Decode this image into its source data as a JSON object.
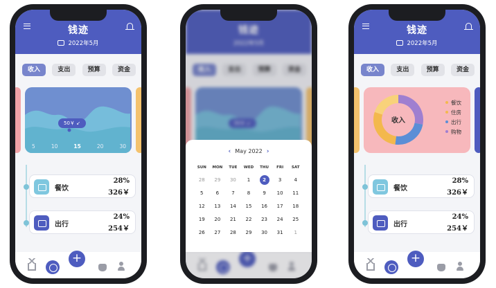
{
  "app": {
    "title": "钱迹",
    "month": "2022年5月"
  },
  "tabs": [
    "收入",
    "支出",
    "预算",
    "资金"
  ],
  "income_chart": {
    "x_ticks": [
      "5",
      "10",
      "15",
      "20",
      "30"
    ],
    "selected_tick": "15",
    "tooltip": "50￥ ↙"
  },
  "pie": {
    "center_label": "收入",
    "legend": [
      {
        "label": "餐饮",
        "color": "#f3b84d"
      },
      {
        "label": "住房",
        "color": "#f3b84d"
      },
      {
        "label": "出行",
        "color": "#5b8ed6"
      },
      {
        "label": "购物",
        "color": "#9f7fd0"
      }
    ],
    "slices": [
      {
        "name": "",
        "value": 28,
        "color": "#9f7fd0"
      },
      {
        "name": "",
        "value": 24,
        "color": "#5b8ed6"
      },
      {
        "name": "",
        "value": 28,
        "color": "#f3b84d"
      },
      {
        "name": "",
        "value": 20,
        "color": "#f8d27a"
      }
    ]
  },
  "entries": [
    {
      "label": "餐饮",
      "percent": "28%",
      "amount": "326￥",
      "icon": "calendar-icon"
    },
    {
      "label": "出行",
      "percent": "24%",
      "amount": "254￥",
      "icon": "calendar-icon"
    }
  ],
  "calendar": {
    "month_label": "May 2022",
    "weekdays": [
      "SUN",
      "MON",
      "TUE",
      "WED",
      "THU",
      "FRI",
      "SAT"
    ],
    "days": [
      "28",
      "29",
      "30",
      "1",
      "2",
      "3",
      "4",
      "5",
      "6",
      "7",
      "8",
      "9",
      "10",
      "11",
      "12",
      "13",
      "14",
      "15",
      "16",
      "17",
      "18",
      "19",
      "20",
      "21",
      "22",
      "23",
      "24",
      "25",
      "26",
      "27",
      "28",
      "29",
      "30",
      "31",
      "1"
    ],
    "muted_days": [
      0,
      1,
      2,
      34
    ],
    "selected_index": 4
  },
  "colors": {
    "primary": "#4e5cbf",
    "teal": "#7fc7df",
    "pink": "#f7b8bc",
    "amber": "#f4c26d"
  }
}
